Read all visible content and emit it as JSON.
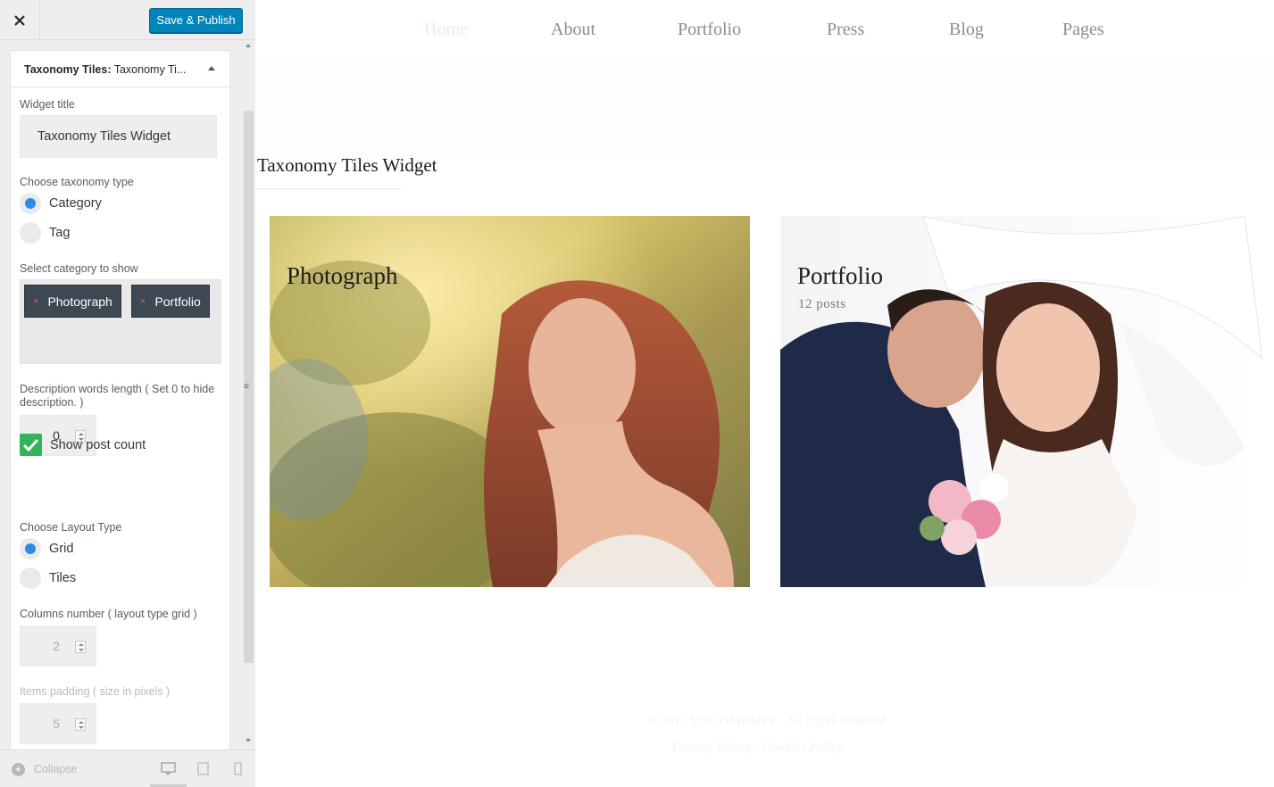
{
  "customizer": {
    "publish_label": "Save & Publish",
    "widget": {
      "header_bold": "Taxonomy Tiles:",
      "header_rest": " Taxonomy Ti...",
      "title_label": "Widget title",
      "title_value": "Taxonomy Tiles Widget",
      "taxonomy_label": "Choose taxonomy type",
      "taxonomy_options": [
        "Category",
        "Tag"
      ],
      "taxonomy_selected": "Category",
      "category_label": "Select category to show",
      "selected_categories": [
        "Photograph",
        "Portfolio"
      ],
      "chip_remove_glyph": "×",
      "desc_label_line1": "Description words length ( Set 0 to hide",
      "desc_label_line2": "description. )",
      "desc_value": "0",
      "post_count_label": "Show post count",
      "post_count_checked": true,
      "layout_label": "Choose Layout Type",
      "layout_options": [
        "Grid",
        "Tiles"
      ],
      "layout_selected": "Grid",
      "columns_label": "Columns number ( layout type grid )",
      "columns_value": "2",
      "padding_label": "Items padding ( size in pixels )",
      "padding_value": "5"
    },
    "footer": {
      "collapse_label": "Collapse",
      "devices": [
        "desktop-icon",
        "tablet-icon",
        "mobile-icon"
      ],
      "active_device": "desktop"
    }
  },
  "preview": {
    "nav": [
      "Home",
      "About",
      "Portfolio",
      "Press",
      "Blog",
      "Pages"
    ],
    "active_nav": "Home",
    "widget_title": "Taxonomy Tiles Widget",
    "tiles": [
      {
        "title": "Photograph",
        "count": ""
      },
      {
        "title": "Portfolio",
        "count": "12 posts"
      }
    ],
    "footer_line1": "© 2017 UNCOMPANY · All rights reserved",
    "footer_line2": "Privacy Policy · Cookies Policy"
  },
  "colors": {
    "primary_button": "#0085ba",
    "radio_selected": "#2e8ae6",
    "checkbox": "#33b35a",
    "chip_bg": "#3d4853"
  }
}
